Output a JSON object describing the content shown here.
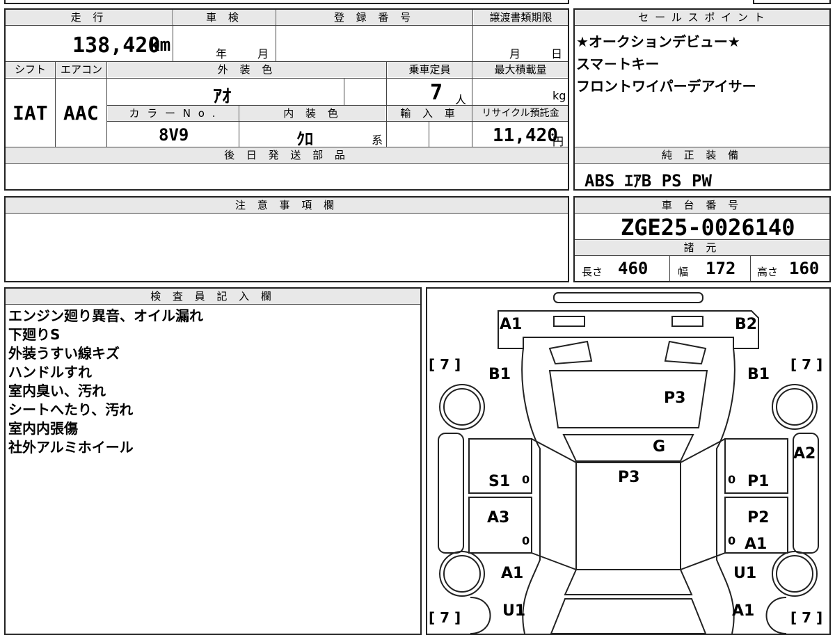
{
  "vehicle": {
    "mileage_label": "走 行",
    "mileage_value": "138,420",
    "mileage_unit": "km",
    "inspection_label": "車 検",
    "year_unit": "年",
    "month_unit": "月",
    "registration_label": "登 録 番 号",
    "transfer_label": "譲渡書類期限",
    "day_unit": "日",
    "shift_label": "シフト",
    "shift_value": "IAT",
    "ac_label": "エアコン",
    "ac_value": "AAC",
    "ext_color_label": "外 装 色",
    "ext_color_value": "ｱｵ",
    "capacity_label": "乗車定員",
    "capacity_value": "7",
    "capacity_unit": "人",
    "max_load_label": "最大積載量",
    "max_load_unit": "kg",
    "color_no_label": "カ ラ ー N o .",
    "color_no_value": "8V9",
    "int_color_label": "内 装 色",
    "int_color_value": "ｸﾛ",
    "int_color_suffix": "系",
    "import_label": "輸 入 車",
    "recycle_label": "リサイクル預託金",
    "recycle_value": "11,420",
    "recycle_unit": "円",
    "later_parts_label": "後 日 発 送 部 品"
  },
  "sales_points": {
    "label": "セ ー ル ス ポ イ ン ト",
    "items": [
      "★オークションデビュー★",
      "スマ－トキー",
      "フロントワイパーデアイサー"
    ]
  },
  "equipment": {
    "label": "純 正 装 備",
    "value": "ABS ｴｱB PS PW"
  },
  "notes": {
    "label": "注 意 事 項 欄"
  },
  "chassis": {
    "label": "車 台 番 号",
    "value": "ZGE25-0026140",
    "specs_label": "諸 元",
    "length_label": "長さ",
    "length_value": "460",
    "width_label": "幅",
    "width_value": "172",
    "height_label": "高さ",
    "height_value": "160"
  },
  "inspector": {
    "label": "検 査 員 記 入 欄",
    "remarks": [
      "エンジン廻り異音、オイル漏れ",
      "下廻りS",
      "外装うすい線キズ",
      "ハンドルすれ",
      "室内臭い、汚れ",
      "シートへたり、汚れ",
      "室内内張傷",
      "社外アルミホイール"
    ]
  },
  "diagram": {
    "marks": [
      "A1",
      "B2",
      "B1",
      "B1",
      "P3",
      "G",
      "A2",
      "P3",
      "S1",
      "P1",
      "A3",
      "P2",
      "A1",
      "A1",
      "U1",
      "U1",
      "A1"
    ],
    "tire_labels": [
      "[ 7 ]",
      "[ 7 ]",
      "[ 7 ]",
      "[ 7 ]"
    ],
    "zeros": [
      "0",
      "0",
      "0",
      "0"
    ]
  }
}
